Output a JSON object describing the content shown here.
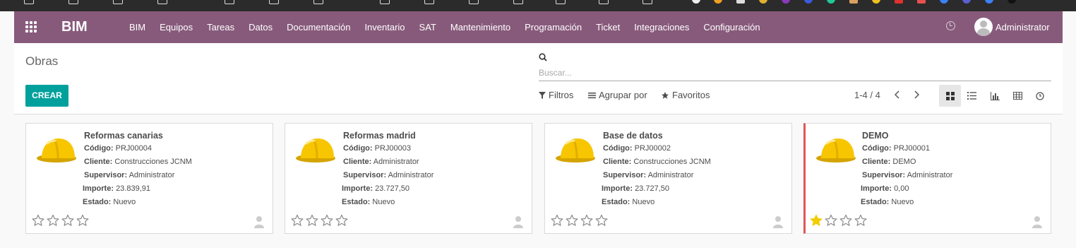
{
  "navbar": {
    "brand": "BIM",
    "menu": [
      "BIM",
      "Equipos",
      "Tareas",
      "Datos",
      "Documentación",
      "Inventario",
      "SAT",
      "Mantenimiento",
      "Programación",
      "Ticket",
      "Integraciones",
      "Configuración"
    ],
    "user": "Administrator",
    "accent": "#875a7b"
  },
  "control_panel": {
    "breadcrumb": "Obras",
    "create_label": "CREAR",
    "search_placeholder": "Buscar...",
    "filters_label": "Filtros",
    "group_by_label": "Agrupar por",
    "favorites_label": "Favoritos",
    "pager": "1-4 / 4",
    "accent": "#00a09d"
  },
  "cards": [
    {
      "title": "Reformas canarias",
      "codigo_label": "Código:",
      "codigo": "PRJ00004",
      "cliente_label": "Cliente:",
      "cliente": "Construcciones JCNM",
      "supervisor_label": "Supervisor:",
      "supervisor": "Administrator",
      "importe_label": "Importe:",
      "importe": "23.839,91",
      "estado_label": "Estado:",
      "estado": "Nuevo",
      "priority": 0,
      "marked": false
    },
    {
      "title": "Reformas madrid",
      "codigo_label": "Código:",
      "codigo": "PRJ00003",
      "cliente_label": "Cliente:",
      "cliente": "Administrator",
      "supervisor_label": "Supervisor:",
      "supervisor": "Administrator",
      "importe_label": "Importe:",
      "importe": "23.727,50",
      "estado_label": "Estado:",
      "estado": "Nuevo",
      "priority": 0,
      "marked": false
    },
    {
      "title": "Base de datos",
      "codigo_label": "Código:",
      "codigo": "PRJ00002",
      "cliente_label": "Cliente:",
      "cliente": "Construcciones JCNM",
      "supervisor_label": "Supervisor:",
      "supervisor": "Administrator",
      "importe_label": "Importe:",
      "importe": "23.727,50",
      "estado_label": "Estado:",
      "estado": "Nuevo",
      "priority": 0,
      "marked": false
    },
    {
      "title": "DEMO",
      "codigo_label": "Código:",
      "codigo": "PRJ00001",
      "cliente_label": "Cliente:",
      "cliente": "DEMO",
      "supervisor_label": "Supervisor:",
      "supervisor": "Administrator",
      "importe_label": "Importe:",
      "importe": "0,00",
      "estado_label": "Estado:",
      "estado": "Nuevo",
      "priority": 1,
      "marked": true
    }
  ]
}
